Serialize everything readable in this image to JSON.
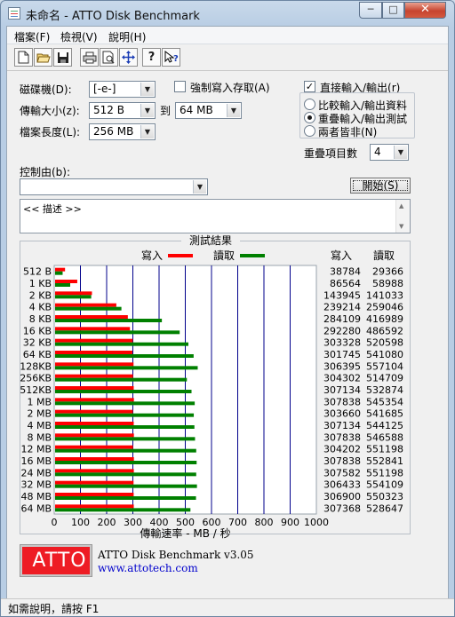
{
  "window": {
    "title": "未命名 - ATTO Disk Benchmark",
    "min_glyph": "─",
    "max_glyph": "□",
    "close_glyph": "✕"
  },
  "menu": [
    {
      "label": "檔案(F)"
    },
    {
      "label": "檢視(V)"
    },
    {
      "label": "說明(H)"
    }
  ],
  "toolbar": {
    "icons": [
      "new-file-icon",
      "open-folder-icon",
      "save-icon",
      "print-icon",
      "print-preview-icon",
      "move-icon",
      "help-icon",
      "context-help-icon"
    ]
  },
  "settings": {
    "drive_label": "磁碟機(D):",
    "drive_value": "[-e-]",
    "transfer_label": "傳輸大小(z):",
    "transfer_from": "512 B",
    "to_label": "到",
    "transfer_to": "64 MB",
    "length_label": "檔案長度(L):",
    "length_value": "256 MB",
    "force_write_label": "強制寫入存取(A)",
    "force_write_checked": false,
    "direct_io_label": "直接輸入/輸出(r)",
    "direct_io_checked": true,
    "io_options": [
      {
        "label": "比較輸入/輸出資料",
        "selected": false
      },
      {
        "label": "重疊輸入/輸出測試",
        "selected": true
      },
      {
        "label": "兩者皆非(N)",
        "selected": false
      }
    ],
    "queue_label": "重疊項目數",
    "queue_value": "4",
    "controlled_by_label": "控制由(b):",
    "controlled_by_value": "",
    "start_button": "開始(S)",
    "description": "<< 描述 >>"
  },
  "results": {
    "title": "測試結果",
    "write_label": "寫入",
    "read_label": "讀取",
    "col_write": "寫入",
    "col_read": "讀取",
    "xlabel": "傳輸速率 - MB / 秒"
  },
  "chart_data": {
    "type": "bar",
    "orientation": "horizontal",
    "title": "測試結果",
    "xlabel": "傳輸速率 - MB / 秒",
    "xlim": [
      0,
      1000
    ],
    "xticks": [
      "0",
      "100",
      "200",
      "300",
      "400",
      "500",
      "600",
      "700",
      "800",
      "900",
      "1000"
    ],
    "grid": true,
    "categories": [
      "512 B",
      "1 KB",
      "2 KB",
      "4 KB",
      "8 KB",
      "16 KB",
      "32 KB",
      "64 KB",
      "128KB",
      "256KB",
      "512KB",
      "1 MB",
      "2 MB",
      "4 MB",
      "8 MB",
      "12 MB",
      "16 MB",
      "24 MB",
      "32 MB",
      "48 MB",
      "64 MB"
    ],
    "series": [
      {
        "name": "寫入",
        "color": "#ff0000",
        "values": [
          38784,
          86564,
          143945,
          239214,
          284109,
          292280,
          303328,
          301745,
          306395,
          304302,
          307134,
          307838,
          303660,
          307134,
          307838,
          304202,
          307838,
          307582,
          306433,
          306900,
          307368
        ]
      },
      {
        "name": "讀取",
        "color": "#008000",
        "values": [
          29366,
          58988,
          141033,
          259046,
          416989,
          486592,
          520598,
          541080,
          557104,
          514709,
          532874,
          545354,
          541685,
          544125,
          546588,
          551198,
          552841,
          551198,
          554109,
          550323,
          528647
        ]
      }
    ],
    "values_unit": "KB/s"
  },
  "footer": {
    "logo_text": "ATTO",
    "product": "ATTO Disk Benchmark v3.05",
    "url": "www.attotech.com",
    "status": "如需說明，請按 F1"
  },
  "colors": {
    "write": "#ff0000",
    "read": "#008000",
    "grid": "#00008b",
    "logo": "#ee1c24",
    "link": "#0000cc"
  }
}
